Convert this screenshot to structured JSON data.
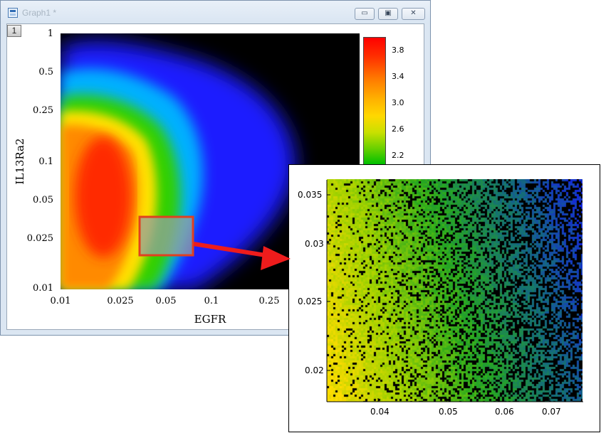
{
  "window": {
    "title": "Graph1 *",
    "layer_label": "1",
    "min_symbol": "▭",
    "max_symbol": "▣",
    "close_symbol": "✕"
  },
  "colors": {
    "accent_arrow": "#ee1c1c",
    "selection_box": "#e04020",
    "plot_background": "#000000"
  },
  "chart_data": [
    {
      "type": "heatmap",
      "xlabel": "EGFR",
      "ylabel": "IL13Ra2",
      "x_scale": "log",
      "y_scale": "log",
      "xlim": [
        0.01,
        0.4
      ],
      "ylim": [
        0.01,
        1
      ],
      "x_ticks": [
        "0.01",
        "0.025",
        "0.05",
        "0.1",
        "0.25"
      ],
      "y_ticks": [
        "1",
        "0.5",
        "0.25",
        "0.1",
        "0.05",
        "0.025",
        "0.01"
      ],
      "colorbar_ticks": [
        "3.8",
        "3.4",
        "3.0",
        "2.6",
        "2.2"
      ],
      "colorbar_colors": [
        "#ff0000",
        "#ff7800",
        "#ffd800",
        "#a0e000",
        "#00c000"
      ],
      "selection_region": {
        "x": [
          0.035,
          0.075
        ],
        "y": [
          0.018,
          0.037
        ]
      }
    },
    {
      "type": "heatmap",
      "x_ticks": [
        "0.04",
        "0.05",
        "0.06",
        "0.07"
      ],
      "y_ticks": [
        "0.035",
        "0.03",
        "0.025",
        "0.02"
      ],
      "xlim": [
        0.033,
        0.075
      ],
      "ylim": [
        0.018,
        0.037
      ]
    }
  ]
}
